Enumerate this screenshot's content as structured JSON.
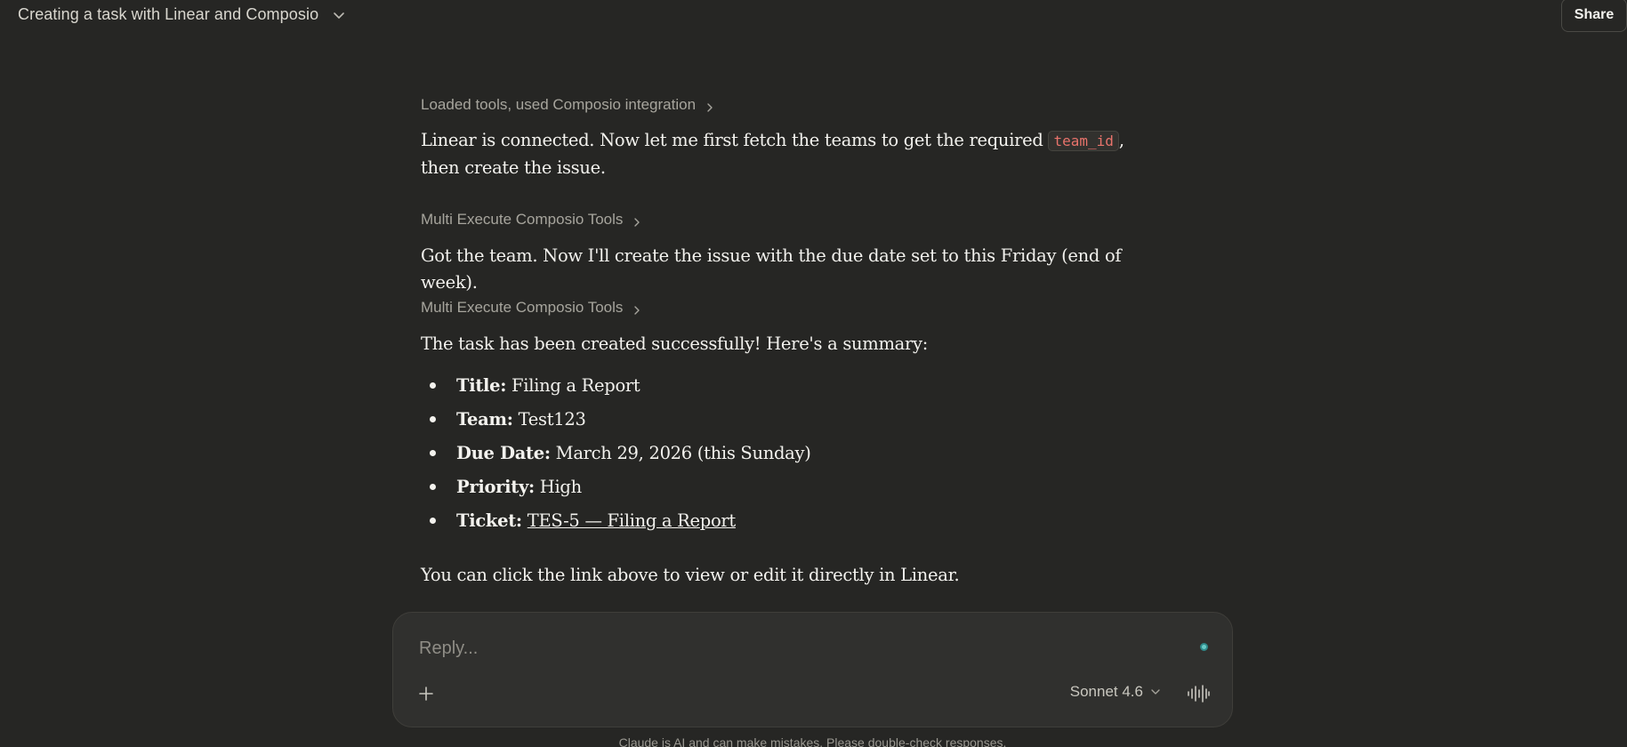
{
  "header": {
    "title": "Creating a task with Linear and Composio",
    "share_label": "Share"
  },
  "conversation": {
    "tool_calls": [
      {
        "label": "Loaded tools, used Composio integration"
      },
      {
        "label": "Multi Execute Composio Tools"
      },
      {
        "label": "Multi Execute Composio Tools"
      }
    ],
    "msg1": {
      "before_code": "Linear is connected. Now let me first fetch the teams to get the required ",
      "code": "team_id",
      "after_code": ", then create the issue."
    },
    "msg2": "Got the team. Now I'll create the issue with the due date set to this Friday (end of week).",
    "msg3": "The task has been created successfully! Here's a summary:",
    "summary": [
      {
        "key": "Title:",
        "value": "Filing a Report"
      },
      {
        "key": "Team:",
        "value": "Test123"
      },
      {
        "key": "Due Date:",
        "value": "March 29, 2026 (this Sunday)"
      },
      {
        "key": "Priority:",
        "value": "High"
      },
      {
        "key": "Ticket:",
        "value": "TES-5 — Filing a Report"
      }
    ],
    "closing": "You can click the link above to view or edit it directly in Linear."
  },
  "composer": {
    "placeholder": "Reply...",
    "value": "",
    "model": "Sonnet 4.6"
  },
  "footer": {
    "disclaimer": "Claude is AI and can make mistakes. Please double-check responses."
  },
  "colors": {
    "background": "#262624",
    "code_text": "#e8736b",
    "status_dot": "#67c9c5"
  }
}
